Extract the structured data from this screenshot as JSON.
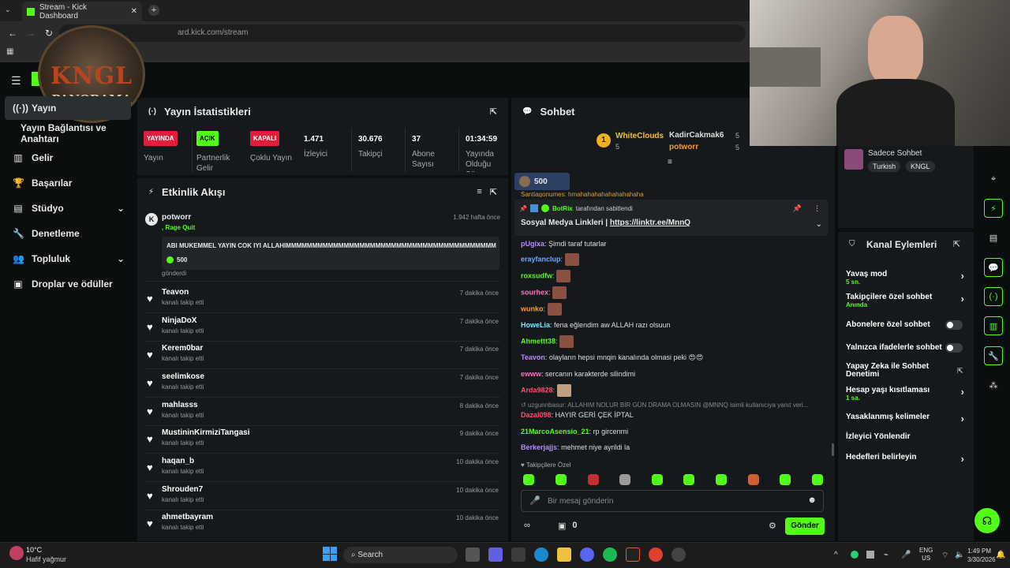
{
  "browser": {
    "tab_title": "Stream - Kick Dashboard",
    "url": "dashboard.kick.com/stream",
    "url_visible": "ard.kick.com/stream"
  },
  "overlay_logo": {
    "line1": "KNGL",
    "line2": "PANORAMA"
  },
  "sidebar": {
    "items": [
      {
        "label": "Yayın",
        "icon": "broadcast-icon"
      },
      {
        "label": "Yayın Bağlantısı ve Anahtarı",
        "icon": ""
      },
      {
        "label": "Gelir",
        "icon": "chart-icon"
      },
      {
        "label": "Başarılar",
        "icon": "trophy-icon"
      },
      {
        "label": "Stüdyo",
        "icon": "studio-icon"
      },
      {
        "label": "Denetleme",
        "icon": "wrench-icon"
      },
      {
        "label": "Topluluk",
        "icon": "people-icon"
      },
      {
        "label": "Droplar ve ödüller",
        "icon": "gift-icon"
      }
    ]
  },
  "stats": {
    "title": "Yayın İstatistikleri",
    "live_badge": "YAYINDA",
    "live_label": "Yayın",
    "partner_badge": "AÇIK",
    "partner_label": "Partnerlik Gelir",
    "multi_badge": "KAPALI",
    "multi_label": "Çoklu Yayın",
    "viewers": "1.471",
    "viewers_label": "İzleyici",
    "followers": "30.676",
    "followers_label": "Takipçi",
    "subs": "37",
    "subs_label": "Abone Sayısı",
    "uptime": "01:34:59",
    "uptime_label": "Yayında Olduğu Sü..."
  },
  "activity": {
    "title": "Etkinlik Akışı",
    "featured": {
      "user": "potworr",
      "sub": ", Rage Quit",
      "time": "1.942 hafta önce",
      "message": "ABI MUKEMMEL YAYIN COK IYI ALLAHIMMMMMMMMMMMMMMMMMMMMMMMMMMMMMMMMMMMMMMMMMM",
      "amount": "500",
      "suffix": "gönderdi"
    },
    "events": [
      {
        "user": "Teavon",
        "action": "kanalı takip etti",
        "time": "7 dakika önce"
      },
      {
        "user": "NinjaDoX",
        "action": "kanalı takip etti",
        "time": "7 dakika önce"
      },
      {
        "user": "Kerem0bar",
        "action": "kanalı takip etti",
        "time": "7 dakika önce"
      },
      {
        "user": "seelimkose",
        "action": "kanalı takip etti",
        "time": "7 dakika önce"
      },
      {
        "user": "mahlasss",
        "action": "kanalı takip etti",
        "time": "8 dakika önce"
      },
      {
        "user": "MustininKirmiziTangasi",
        "action": "kanalı takip etti",
        "time": "9 dakika önce"
      },
      {
        "user": "haqan_b",
        "action": "kanalı takip etti",
        "time": "10 dakika önce"
      },
      {
        "user": "Shrouden7",
        "action": "kanalı takip etti",
        "time": "10 dakika önce"
      },
      {
        "user": "ahmetbayram",
        "action": "kanalı takip etti",
        "time": "10 dakika önce"
      }
    ]
  },
  "chat": {
    "title": "Sohbet",
    "leaderboard": [
      {
        "rank": "1",
        "user": "WhiteClouds",
        "count": "5"
      },
      {
        "rank": "",
        "user": "KadirCakmak6",
        "count": "5"
      },
      {
        "rank": "",
        "user": "potworr",
        "count": "5"
      }
    ],
    "gift_count": "500",
    "truncated_top": "Santiagonumes: hmahahahahahahahahaha",
    "pinned": {
      "by": "BotRix",
      "by_suffix": "tarafından sabitlendi",
      "label": "Sosyal Medya Linkleri |",
      "link": "https://linktr.ee/MnnQ"
    },
    "messages": [
      {
        "user": "pUgixa",
        "color": "#b48cff",
        "text": "Şimdi taraf tutarlar",
        "emote": false
      },
      {
        "user": "erayfanclup",
        "color": "#6fa8ff",
        "text": "",
        "emote": true
      },
      {
        "user": "roxsudfw",
        "color": "#53fc18",
        "text": "",
        "emote": true
      },
      {
        "user": "sourhex",
        "color": "#ff6fc3",
        "text": "",
        "emote": true
      },
      {
        "user": "wunko",
        "color": "#ff9b2f",
        "text": "",
        "emote": true
      },
      {
        "user": "HoweLia",
        "color": "#6fe8ff",
        "text": "fena eğlendim aw ALLAH razı olsuun",
        "emote": false
      },
      {
        "user": "Ahmettt38",
        "color": "#53fc18",
        "text": "",
        "emote": true
      },
      {
        "user": "Teavon",
        "color": "#b48cff",
        "text": "olayların hepsi mnqin kanalında olmasi peki 😍😍",
        "emote": false
      },
      {
        "user": "ewww",
        "color": "#ff6fc3",
        "text": "sercanın karakterde silindimi",
        "emote": false
      },
      {
        "user": "Arda9828",
        "color": "#ff4d6d",
        "text": "",
        "emote": true
      }
    ],
    "reply_preview": "uzgunnbasur: ALLAHIM NOLUR BİR GÜN DRAMA OLMASIN @MNNQ isimli kullanıcıya yanıt veri...",
    "messages2": [
      {
        "user": "Dazal098",
        "color": "#ff4d6d",
        "text": "HAYIR GERİ ÇEK İPTAL"
      },
      {
        "user": "21MarcoAsensio_21",
        "color": "#53fc18",
        "text": "rp gircenmi"
      },
      {
        "user": "Berkerjajjs",
        "color": "#b48cff",
        "text": "mehmet niye ayrildi la"
      }
    ],
    "followers_only": "Takipçilere Özel",
    "input_placeholder": "Bir mesaj gönderin",
    "points": "0",
    "send_label": "Gönder"
  },
  "webcam_panel": {
    "label": "Sadece Sohbet",
    "tags": [
      "Turkish",
      "KNGL"
    ]
  },
  "channel_actions": {
    "title": "Kanal Eylemleri",
    "rows": [
      {
        "label": "Yavaş mod",
        "sub": "5 sn.",
        "type": "arrow"
      },
      {
        "label": "Takipçilere özel sohbet",
        "sub": "Anında",
        "type": "arrow"
      },
      {
        "label": "Abonelere özel sohbet",
        "sub": "",
        "type": "toggle"
      },
      {
        "label": "Yalnızca ifadelerle sohbet",
        "sub": "",
        "type": "toggle"
      },
      {
        "label": "Yapay Zeka ile Sohbet Denetimi",
        "sub": "",
        "type": "external"
      },
      {
        "label": "Hesap yaşı kısıtlaması",
        "sub": "1 sa.",
        "type": "arrow"
      },
      {
        "label": "Yasaklanmış kelimeler",
        "sub": "",
        "type": "arrow"
      },
      {
        "label": "İzleyici Yönlendir",
        "sub": "",
        "type": "none"
      },
      {
        "label": "Hedefleri belirleyin",
        "sub": "",
        "type": "arrow"
      }
    ]
  },
  "taskbar": {
    "weather_temp": "10°C",
    "weather_desc": "Hafif yağmur",
    "search": "Search",
    "lang": "ENG",
    "region": "US",
    "time": "1:49 PM",
    "date": "3/30/2026"
  },
  "colors": {
    "accent": "#53fc18",
    "bg": "#0b0e0f",
    "panel": "#16191b",
    "live": "#e01e3c"
  }
}
